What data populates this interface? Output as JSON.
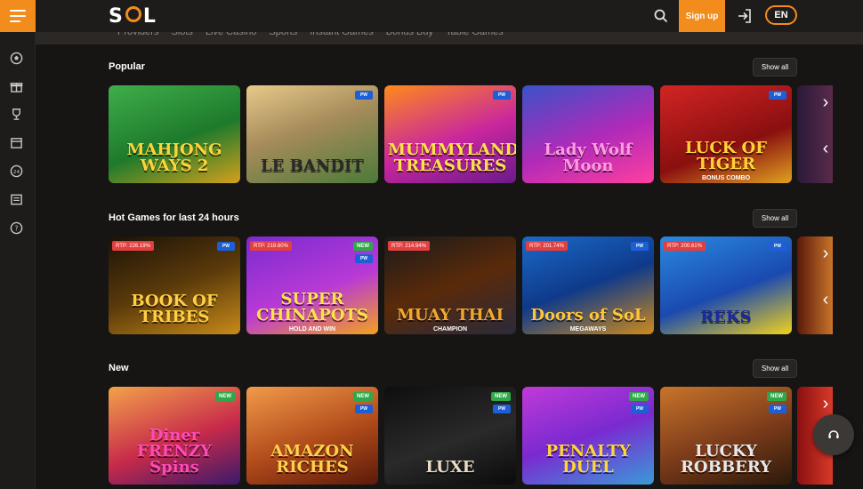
{
  "header": {
    "logo_text": "SOL",
    "signup_label": "Sign up",
    "language": "EN"
  },
  "nav": {
    "items": [
      "Providers",
      "Slots",
      "Live Casino",
      "Sports",
      "Instant Games",
      "Bonus Buy",
      "Table Games"
    ]
  },
  "sidebar": {
    "icons": [
      "football-icon",
      "gift-icon",
      "trophy-icon",
      "calendar-icon",
      "24h-icon",
      "news-icon",
      "help-icon"
    ]
  },
  "sections": [
    {
      "title": "Popular",
      "show_all": "Show all",
      "games": [
        {
          "title": "MAHJONG WAYS 2",
          "badges": []
        },
        {
          "title": "LE BANDIT",
          "badges": [
            "pw"
          ]
        },
        {
          "title": "MUMMYLAND TREASURES",
          "badges": [
            "pw"
          ]
        },
        {
          "title": "Lady Wolf Moon",
          "badges": []
        },
        {
          "title": "LUCK OF TIGER",
          "subtitle": "BONUS COMBO",
          "badges": [
            "pw"
          ]
        }
      ]
    },
    {
      "title": "Hot Games for last 24 hours",
      "show_all": "Show all",
      "games": [
        {
          "title": "BOOK OF TRIBES",
          "rtp": "RTP: 226.19%",
          "badges": [
            "pw"
          ]
        },
        {
          "title": "SUPER CHINAPOTS",
          "subtitle": "HOLD AND WIN",
          "rtp": "RTP: 219.80%",
          "badges": [
            "new",
            "pw"
          ]
        },
        {
          "title": "MUAY THAI",
          "subtitle": "CHAMPION",
          "rtp": "RTP: 214.94%",
          "badges": []
        },
        {
          "title": "Doors of SoL",
          "subtitle": "MEGAWAYS",
          "rtp": "RTP: 201.74%",
          "badges": [
            "pw"
          ]
        },
        {
          "title": "REKS",
          "rtp": "RTP: 200.61%",
          "badges": [
            "pw"
          ]
        }
      ]
    },
    {
      "title": "New",
      "show_all": "Show all",
      "games": [
        {
          "title": "Diner FRENZY Spins",
          "badges": [
            "new"
          ]
        },
        {
          "title": "AMAZON RICHES",
          "badges": [
            "new",
            "pw"
          ]
        },
        {
          "title": "LUXE",
          "badges": [
            "new",
            "pw"
          ]
        },
        {
          "title": "PENALTY DUEL",
          "badges": [
            "new",
            "pw"
          ]
        },
        {
          "title": "LUCKY ROBBERY",
          "badges": [
            "new",
            "pw"
          ]
        }
      ]
    }
  ],
  "badge_labels": {
    "new": "NEW",
    "pw": "PW"
  },
  "colors": {
    "accent": "#f28c1d",
    "background": "#161514",
    "new_badge": "#2fa84a",
    "rtp_badge": "#e33f3f",
    "provider_badge": "#1d5fd6"
  }
}
